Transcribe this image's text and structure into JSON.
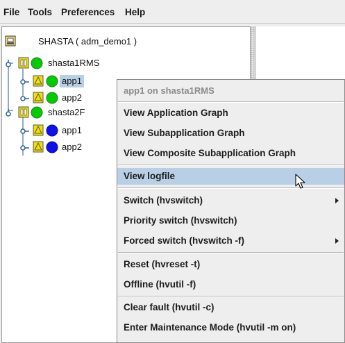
{
  "menubar": {
    "file": "File",
    "tools": "Tools",
    "preferences": "Preferences",
    "help": "Help"
  },
  "tree": {
    "root_label": "SHASTA ( adm_demo1 )",
    "nodes": [
      {
        "label": "shasta1RMS",
        "status_color": "#00cc00"
      },
      {
        "label": "app1",
        "status_color": "#00cc00"
      },
      {
        "label": "app2",
        "status_color": "#00cc00"
      },
      {
        "label": "shasta2F",
        "status_color": "#00cc00"
      },
      {
        "label": "app1",
        "status_color": "#1010ee"
      },
      {
        "label": "app2",
        "status_color": "#1010ee"
      }
    ]
  },
  "context_menu": {
    "title": "app1 on shasta1RMS",
    "items": [
      {
        "label": "View Application Graph"
      },
      {
        "label": "View Subapplication Graph"
      },
      {
        "label": "View Composite Subapplication Graph"
      },
      {
        "label": "View logfile",
        "highlighted": true
      },
      {
        "label": "Switch (hvswitch)",
        "has_submenu": true
      },
      {
        "label": "Priority switch (hvswitch)"
      },
      {
        "label": "Forced switch (hvswitch -f)",
        "has_submenu": true
      },
      {
        "label": "Reset (hvreset -t)"
      },
      {
        "label": "Offline (hvutil -f)"
      },
      {
        "label": "Clear fault (hvutil -c)"
      },
      {
        "label": "Enter Maintenance Mode (hvutil -m on)"
      }
    ]
  },
  "colors": {
    "selection": "#b8cfe5",
    "status_online": "#00cc00",
    "status_offline": "#1010ee",
    "node_icon": "#f0e000"
  }
}
